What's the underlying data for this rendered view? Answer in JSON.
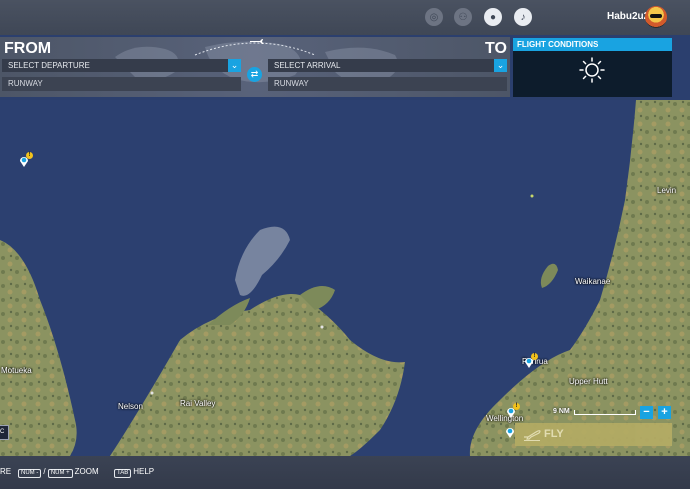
{
  "topbar": {
    "username": "Habu2u2",
    "icons": [
      "achievements-icon",
      "friends-icon",
      "profile-icon",
      "notifications-icon"
    ]
  },
  "flight": {
    "from_label": "FROM",
    "to_label": "TO",
    "departure_placeholder": "SELECT DEPARTURE",
    "arrival_placeholder": "SELECT ARRIVAL",
    "departure_runway": "RUNWAY",
    "arrival_runway": "RUNWAY"
  },
  "conditions": {
    "title": "FLIGHT CONDITIONS",
    "weather_icon": "sun-icon"
  },
  "map": {
    "labels": {
      "levin": "Levin",
      "waikanae": "Waikanae",
      "porirua": "Porirua",
      "upper_hutt": "Upper Hutt",
      "wellington": "Wellington",
      "motueka": "Motueka",
      "nelson": "Nelson",
      "rai_valley": "Rai Valley"
    },
    "scale": "9 NM",
    "zoom_out": "−",
    "zoom_in": "+",
    "fly_label": "FLY",
    "side_button": "C"
  },
  "colors": {
    "accent": "#19a3e1",
    "sea": "#2b3f6e",
    "land": "#8c9362",
    "fly": "#b3ab64"
  },
  "bottombar": {
    "cut_text": "RE",
    "zoom_keys": [
      "NUM -",
      "NUM +"
    ],
    "zoom_sep": "/",
    "zoom_label": "ZOOM",
    "help_key": "TAB",
    "help_label": "HELP"
  }
}
